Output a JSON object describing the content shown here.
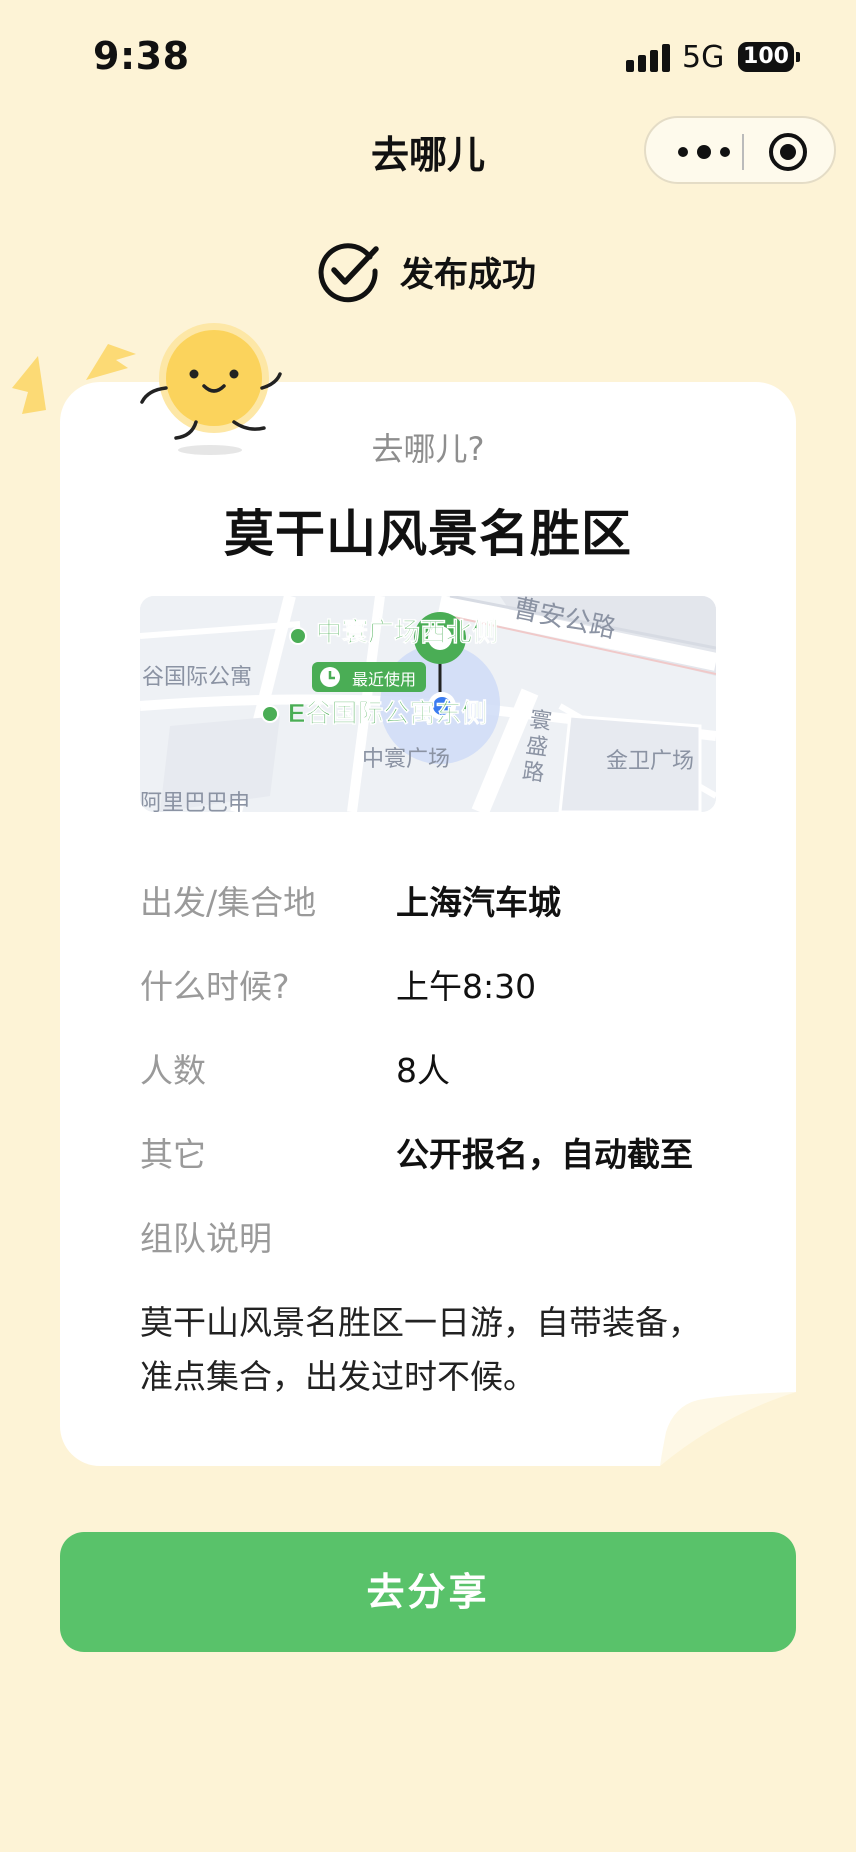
{
  "status_bar": {
    "time": "9:38",
    "network": "5G",
    "battery": "100"
  },
  "nav": {
    "title": "去哪儿"
  },
  "success": {
    "text": "发布成功",
    "icon": "check-circle-icon"
  },
  "card": {
    "question": "去哪儿?",
    "destination": "莫干山风景名胜区",
    "map": {
      "labels": [
        "中寰广场西北侧",
        "最近使用",
        "E谷国际公寓东侧",
        "谷国际公寓",
        "中寰广场",
        "寰盛路",
        "金卫广场",
        "曹安公路",
        "阿里巴巴申"
      ]
    },
    "details": [
      {
        "label": "出发/集合地",
        "value": "上海汽车城"
      },
      {
        "label": "什么时候?",
        "value": "上午8:30"
      },
      {
        "label": "人数",
        "value": "8人"
      },
      {
        "label": "其它",
        "value": "公开报名，自动截至"
      },
      {
        "label": "组队说明",
        "value": ""
      }
    ],
    "description": "莫干山风景名胜区一日游，自带装备，准点集合，出发过时不候。"
  },
  "share_button": {
    "label": "去分享"
  },
  "colors": {
    "background": "#fdf3d6",
    "accent_green": "#59c26a",
    "map_green": "#4aad55"
  }
}
